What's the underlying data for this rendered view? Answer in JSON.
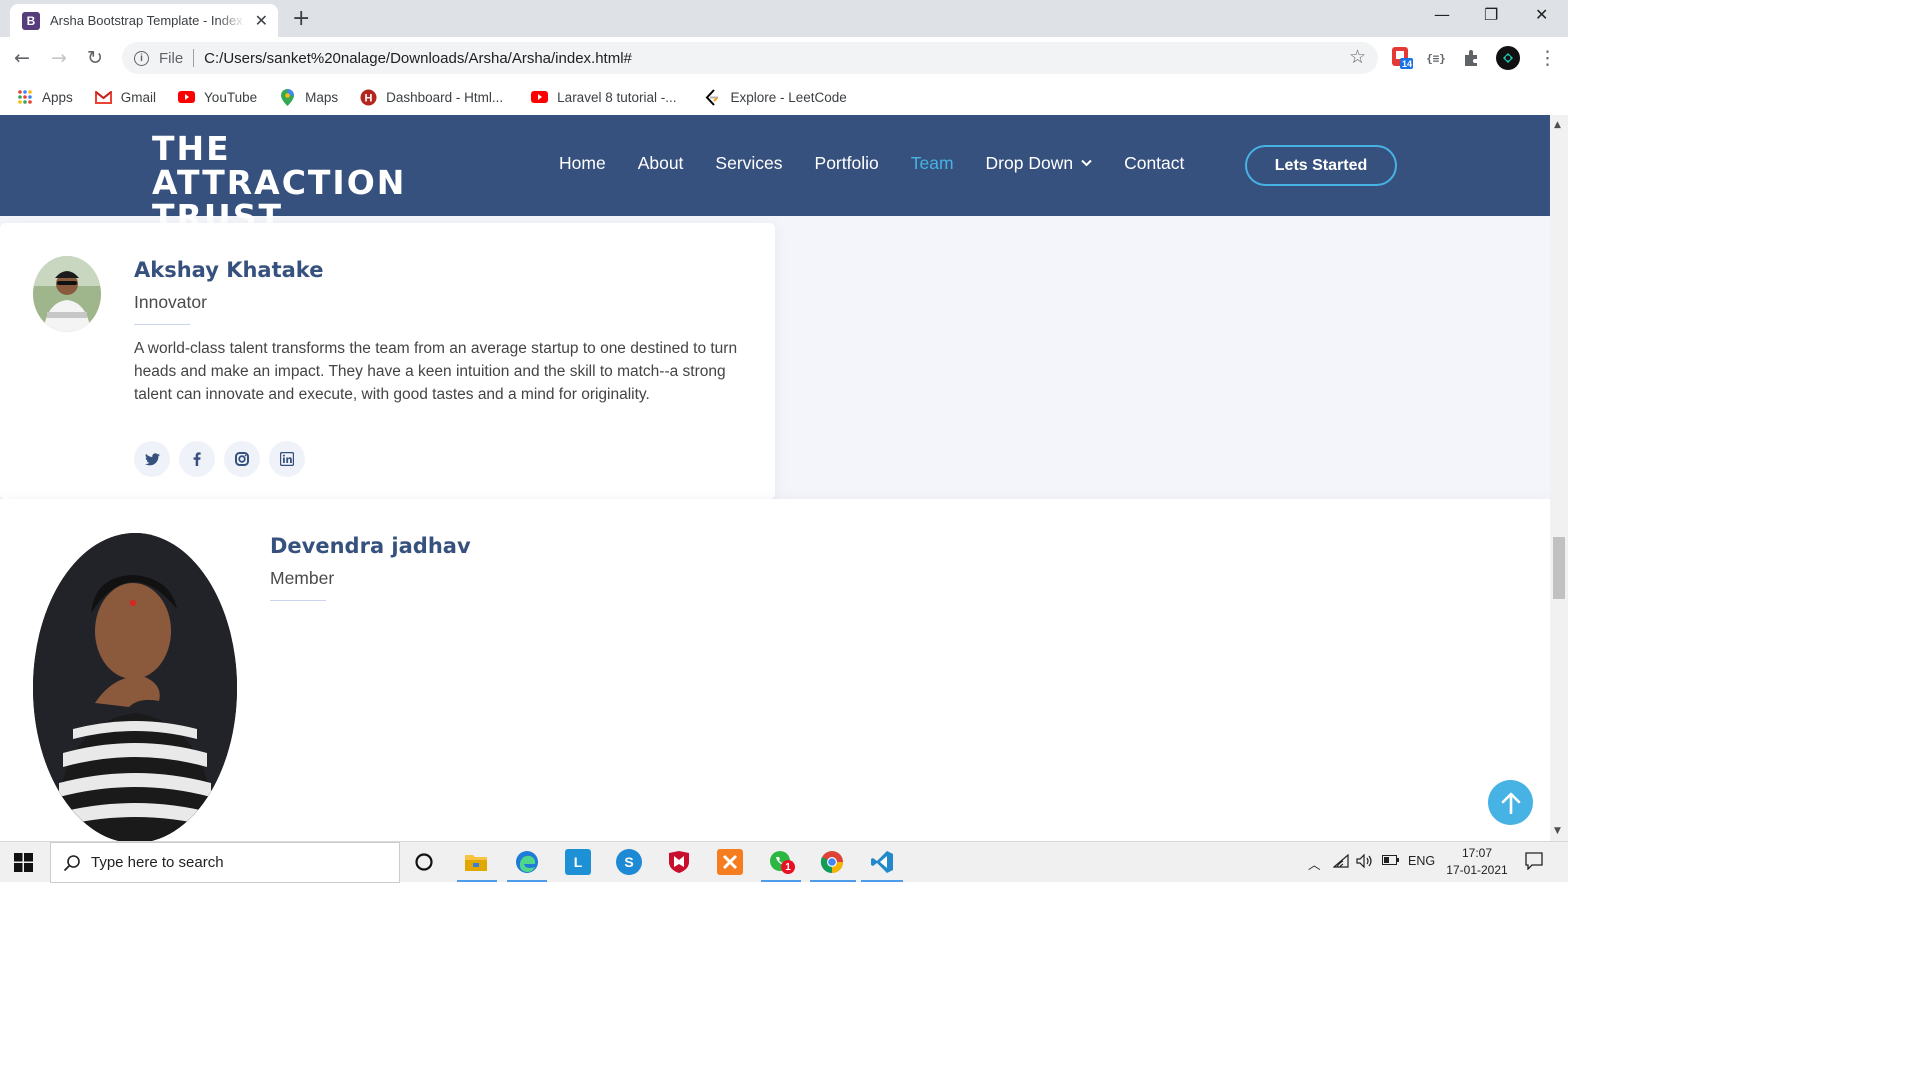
{
  "browser": {
    "tab_title": "Arsha Bootstrap Template - Index",
    "tab_favicon_letter": "B",
    "new_tab_symbol": "+",
    "close_symbol": "✕",
    "address_scheme": "File",
    "address_url": "C:/Users/sanket%20nalage/Downloads/Arsha/Arsha/index.html#",
    "extension_badge": "14",
    "bookmarks": [
      {
        "label": "Apps",
        "icon": "apps-grid-icon"
      },
      {
        "label": "Gmail",
        "icon": "gmail-icon"
      },
      {
        "label": "YouTube",
        "icon": "youtube-icon"
      },
      {
        "label": "Maps",
        "icon": "maps-pin-icon"
      },
      {
        "label": "Dashboard - Html...",
        "icon": "h-logo-icon"
      },
      {
        "label": "Laravel 8 tutorial -...",
        "icon": "youtube-icon"
      },
      {
        "label": "Explore - LeetCode",
        "icon": "leetcode-icon"
      }
    ]
  },
  "site": {
    "logo": "THE ATTRACTION TRUST",
    "nav": [
      {
        "label": "Home",
        "active": false
      },
      {
        "label": "About",
        "active": false
      },
      {
        "label": "Services",
        "active": false
      },
      {
        "label": "Portfolio",
        "active": false
      },
      {
        "label": "Team",
        "active": true
      },
      {
        "label": "Drop Down",
        "active": false
      },
      {
        "label": "Contact",
        "active": false
      }
    ],
    "cta_label": "Lets Started",
    "accent_color": "#47b2e4",
    "header_color": "#37517e"
  },
  "team": [
    {
      "name": "Akshay Khatake",
      "role": "Innovator",
      "bio": "A world-class talent transforms the team from an average startup to one destined to turn heads and make an impact. They have a keen intuition and the skill to match--a strong talent can innovate and execute, with good tastes and a mind for originality.",
      "socials": [
        "twitter-icon",
        "facebook-icon",
        "instagram-icon",
        "linkedin-icon"
      ]
    },
    {
      "name": "Devendra jadhav",
      "role": "Member"
    }
  ],
  "taskbar": {
    "search_placeholder": "Type here to search",
    "whatsapp_badge": "1",
    "language": "ENG",
    "time": "17:07",
    "date": "17-01-2021"
  }
}
